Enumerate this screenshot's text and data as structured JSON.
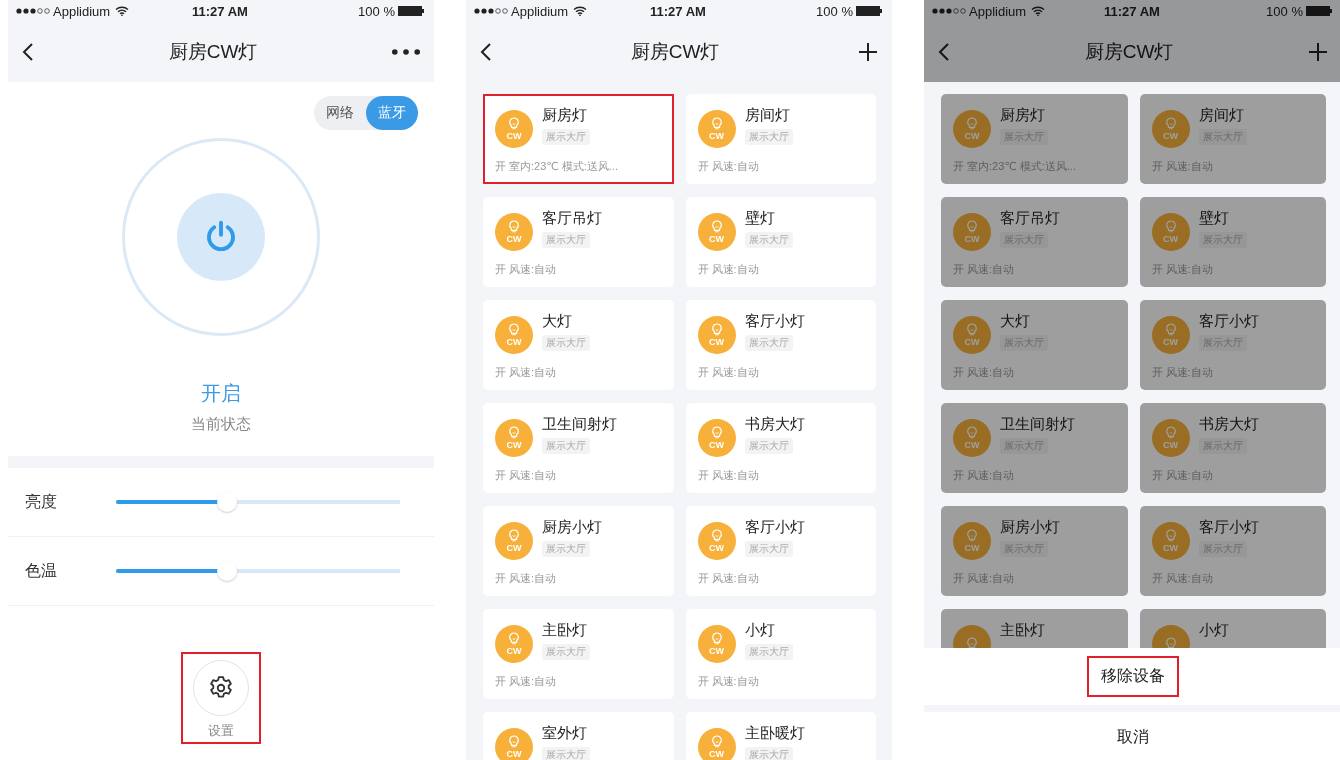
{
  "screens": [
    {
      "kind": "detail",
      "status_bar": {
        "carrier": "Applidium",
        "time": "11:27 AM",
        "battery": "100 %"
      },
      "nav": {
        "title": "厨房CW灯",
        "right_icon": {
          "kind": "more"
        }
      },
      "mode_toggle": [
        {
          "label": "网络",
          "selected": false
        },
        {
          "label": "蓝牙",
          "selected": true
        }
      ],
      "power": {
        "on": true,
        "state": "开启",
        "caption": "当前状态"
      },
      "sliders": [
        {
          "label": "亮度",
          "level": 0.39
        },
        {
          "label": "色温",
          "level": 0.39
        }
      ],
      "settings": {
        "label": "设置",
        "highlighted": true
      }
    },
    {
      "kind": "list",
      "dimmed": false,
      "status_bar": {
        "carrier": "Applidium",
        "time": "11:27 AM",
        "battery": "100 %"
      },
      "nav": {
        "title": "厨房CW灯",
        "right_icon": {
          "kind": "add"
        }
      },
      "cards": [
        {
          "name": "厨房灯",
          "icon_label": "CW",
          "room": "展示大厅",
          "status": "开 室内:23℃ 模式:送风...",
          "highlighted": true
        },
        {
          "name": "房间灯",
          "icon_label": "CW",
          "room": "展示大厅",
          "status": "开 风速:自动",
          "highlighted": false
        },
        {
          "name": "客厅吊灯",
          "icon_label": "CW",
          "room": "展示大厅",
          "status": "开 风速:自动",
          "highlighted": false
        },
        {
          "name": "壁灯",
          "icon_label": "CW",
          "room": "展示大厅",
          "status": "开 风速:自动",
          "highlighted": false
        },
        {
          "name": "大灯",
          "icon_label": "CW",
          "room": "展示大厅",
          "status": "开 风速:自动",
          "highlighted": false
        },
        {
          "name": "客厅小灯",
          "icon_label": "CW",
          "room": "展示大厅",
          "status": "开 风速:自动",
          "highlighted": false
        },
        {
          "name": "卫生间射灯",
          "icon_label": "CW",
          "room": "展示大厅",
          "status": "开 风速:自动",
          "highlighted": false
        },
        {
          "name": "书房大灯",
          "icon_label": "CW",
          "room": "展示大厅",
          "status": "开 风速:自动",
          "highlighted": false
        },
        {
          "name": "厨房小灯",
          "icon_label": "CW",
          "room": "展示大厅",
          "status": "开 风速:自动",
          "highlighted": false
        },
        {
          "name": "客厅小灯",
          "icon_label": "CW",
          "room": "展示大厅",
          "status": "开 风速:自动",
          "highlighted": false
        },
        {
          "name": "主卧灯",
          "icon_label": "CW",
          "room": "展示大厅",
          "status": "开 风速:自动",
          "highlighted": false
        },
        {
          "name": "小灯",
          "icon_label": "CW",
          "room": "展示大厅",
          "status": "开 风速:自动",
          "highlighted": false
        },
        {
          "name": "室外灯",
          "icon_label": "CW",
          "room": "展示大厅",
          "highlighted": false
        },
        {
          "name": "主卧暖灯",
          "icon_label": "CW",
          "room": "展示大厅",
          "highlighted": false
        }
      ]
    },
    {
      "kind": "list",
      "dimmed": true,
      "status_bar": {
        "carrier": "Applidium",
        "time": "11:27 AM",
        "battery": "100 %"
      },
      "nav": {
        "title": "厨房CW灯",
        "right_icon": {
          "kind": "add"
        }
      },
      "cards": [
        {
          "name": "厨房灯",
          "icon_label": "CW",
          "room": "展示大厅",
          "status": "开 室内:23℃ 模式:送风...",
          "highlighted": false
        },
        {
          "name": "房间灯",
          "icon_label": "CW",
          "room": "展示大厅",
          "status": "开 风速:自动",
          "highlighted": false
        },
        {
          "name": "客厅吊灯",
          "icon_label": "CW",
          "room": "展示大厅",
          "status": "开 风速:自动",
          "highlighted": false
        },
        {
          "name": "壁灯",
          "icon_label": "CW",
          "room": "展示大厅",
          "status": "开 风速:自动",
          "highlighted": false
        },
        {
          "name": "大灯",
          "icon_label": "CW",
          "room": "展示大厅",
          "status": "开 风速:自动",
          "highlighted": false
        },
        {
          "name": "客厅小灯",
          "icon_label": "CW",
          "room": "展示大厅",
          "status": "开 风速:自动",
          "highlighted": false
        },
        {
          "name": "卫生间射灯",
          "icon_label": "CW",
          "room": "展示大厅",
          "status": "开 风速:自动",
          "highlighted": false
        },
        {
          "name": "书房大灯",
          "icon_label": "CW",
          "room": "展示大厅",
          "status": "开 风速:自动",
          "highlighted": false
        },
        {
          "name": "厨房小灯",
          "icon_label": "CW",
          "room": "展示大厅",
          "status": "开 风速:自动",
          "highlighted": false
        },
        {
          "name": "客厅小灯",
          "icon_label": "CW",
          "room": "展示大厅",
          "status": "开 风速:自动",
          "highlighted": false
        },
        {
          "name": "主卧灯",
          "highlighted": false
        },
        {
          "name": "小灯",
          "highlighted": false
        }
      ],
      "action_sheet": [
        {
          "label": "移除设备",
          "highlighted": true
        },
        {
          "label": "取消",
          "highlighted": false
        }
      ]
    }
  ]
}
